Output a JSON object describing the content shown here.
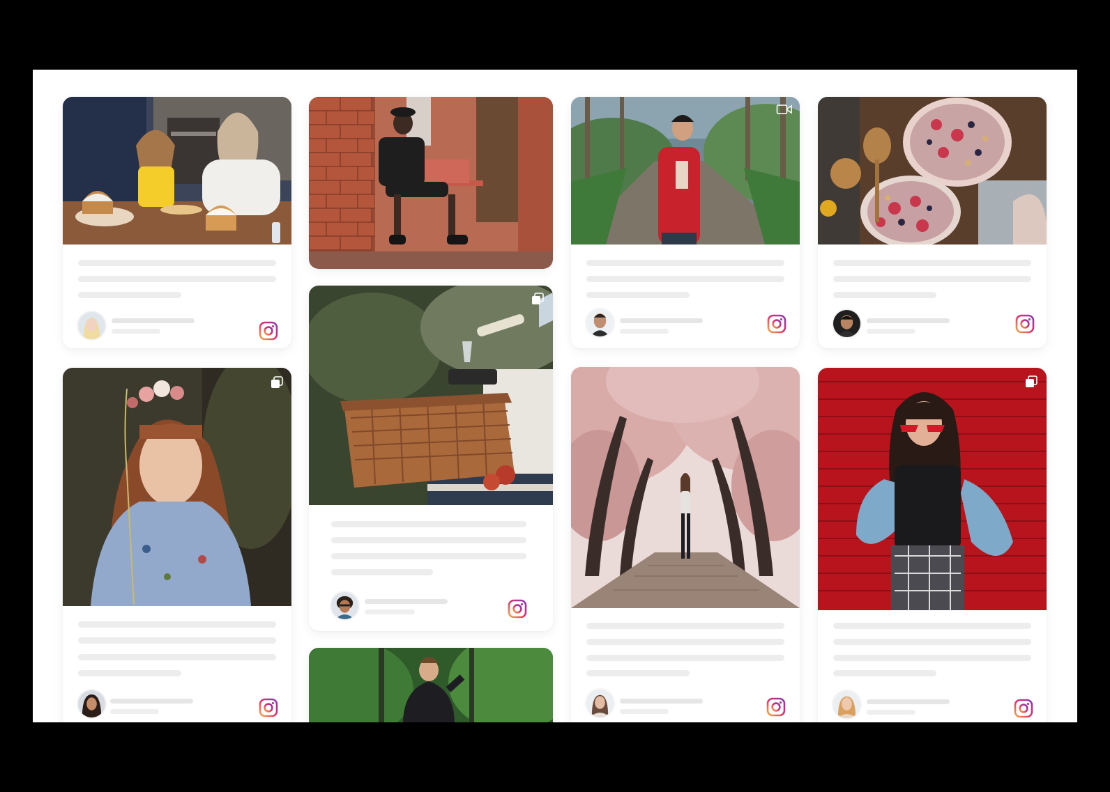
{
  "feed": {
    "network": "instagram",
    "icon_names": [
      "instagram-icon",
      "gallery-icon",
      "video-icon"
    ],
    "brand_colors": {
      "ig_start": "#f9a94a",
      "ig_mid": "#e1306c",
      "ig_end": "#833ab4"
    },
    "posts": [
      {
        "media": "photo",
        "subject": "family-cake-photo"
      },
      {
        "media": "photo",
        "subject": "man-on-bench-photo"
      },
      {
        "media": "video",
        "subject": "man-on-path-photo"
      },
      {
        "media": "photo",
        "subject": "fruit-bowls-photo"
      },
      {
        "media": "carousel",
        "subject": "girl-flower-crown-photo"
      },
      {
        "media": "carousel",
        "subject": "picnic-basket-photo"
      },
      {
        "media": "photo",
        "subject": "cherry-blossom-photo"
      },
      {
        "media": "carousel",
        "subject": "woman-red-wall-photo"
      },
      {
        "media": "photo",
        "subject": "man-in-forest-photo"
      }
    ]
  }
}
